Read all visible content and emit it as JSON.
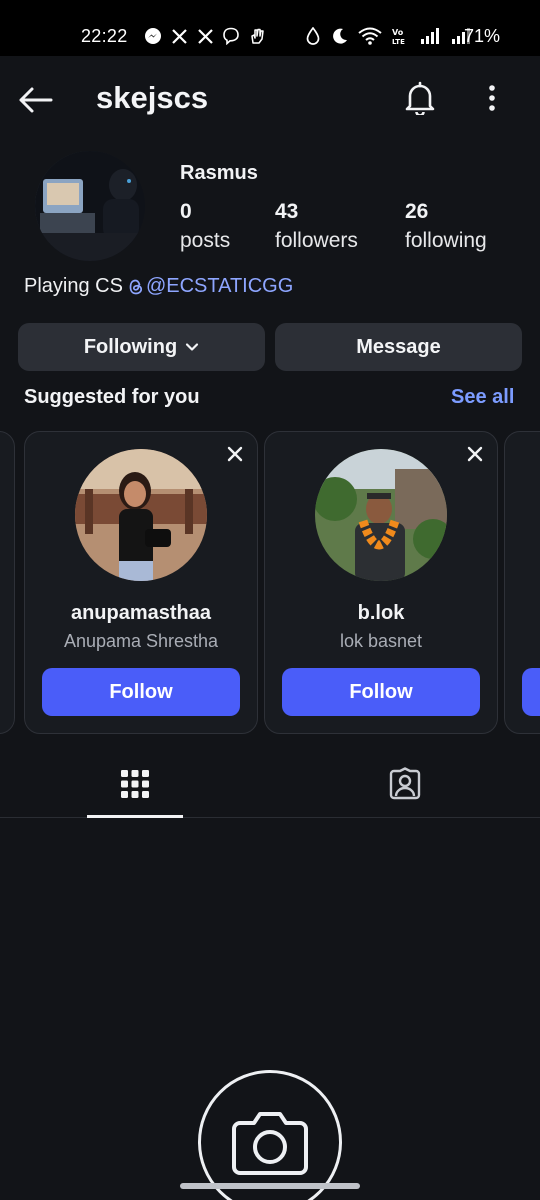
{
  "status_bar": {
    "time": "22:22",
    "battery": "71%",
    "left_icons": [
      "messenger-icon",
      "x-icon",
      "x-icon",
      "viber-icon",
      "hand-icon"
    ],
    "right_icons": [
      "water-drop-icon",
      "moon-icon",
      "wifi-icon",
      "volte-icon",
      "signal-icon",
      "signal-icon"
    ],
    "volte_text": "VoLTE"
  },
  "header": {
    "username": "skejscs"
  },
  "profile": {
    "display_name": "Rasmus",
    "stats": [
      {
        "value": "0",
        "label": "posts"
      },
      {
        "value": "43",
        "label": "followers"
      },
      {
        "value": "26",
        "label": "following"
      }
    ],
    "bio_text": "Playing CS",
    "bio_link": "@ECSTATICGG"
  },
  "actions": {
    "following_label": "Following",
    "message_label": "Message"
  },
  "suggested": {
    "title": "Suggested for you",
    "see_all": "See all",
    "cards": [
      {
        "username": "anupamasthaa",
        "full_name": "Anupama Shrestha",
        "button": "Follow"
      },
      {
        "username": "b.lok",
        "full_name": "lok basnet",
        "button": "Follow"
      }
    ]
  },
  "tabs": [
    {
      "name": "grid",
      "icon": "grid-icon",
      "active": true
    },
    {
      "name": "tagged",
      "icon": "tagged-person-icon",
      "active": false
    }
  ],
  "colors": {
    "background": "#121418",
    "accent": "#4a5df9",
    "link": "#7c9cff",
    "button": "#2c2f36"
  }
}
